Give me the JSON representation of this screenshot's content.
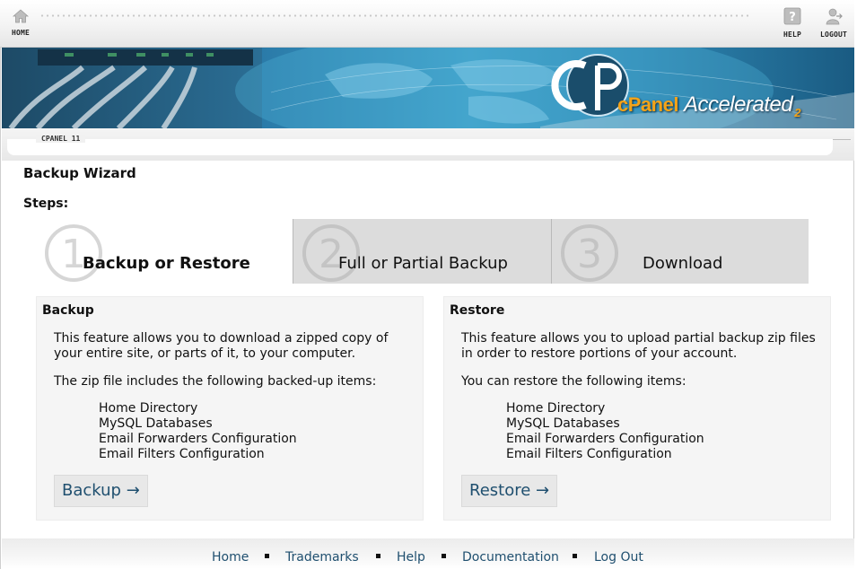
{
  "toolbar": {
    "home_label": "HOME",
    "help_label": "HELP",
    "logout_label": "LOGOUT"
  },
  "banner": {
    "brand_cpanel": "cPanel",
    "brand_accelerated": "Accelerated",
    "brand_version": "2",
    "version_label": "CPANEL 11"
  },
  "page": {
    "title": "Backup Wizard",
    "steps_label": "Steps:"
  },
  "steps": [
    {
      "number": "1",
      "label": "Backup or Restore",
      "active": true
    },
    {
      "number": "2",
      "label": "Full or Partial Backup",
      "active": false
    },
    {
      "number": "3",
      "label": "Download",
      "active": false
    }
  ],
  "backup": {
    "title": "Backup",
    "description": "This feature allows you to download a zipped copy of your entire site, or parts of it, to your computer.",
    "includes_label": "The zip file includes the following backed-up items:",
    "items": [
      "Home Directory",
      "MySQL Databases",
      "Email Forwarders Configuration",
      "Email Filters Configuration"
    ],
    "button_label": "Backup →"
  },
  "restore": {
    "title": "Restore",
    "description": "This feature allows you to upload partial backup zip files in order to restore portions of your account.",
    "includes_label": "You can restore the following items:",
    "items": [
      "Home Directory",
      "MySQL Databases",
      "Email Forwarders Configuration",
      "Email Filters Configuration"
    ],
    "button_label": "Restore →"
  },
  "footer": {
    "links": [
      "Home",
      "Trademarks",
      "Help",
      "Documentation",
      "Log Out"
    ]
  },
  "colors": {
    "link": "#1f4f6f",
    "banner_blue": "#2a7aa8",
    "brand_orange": "#f4a318",
    "inactive_tab": "#dcdcdc",
    "panel_bg": "#f5f5f5"
  }
}
